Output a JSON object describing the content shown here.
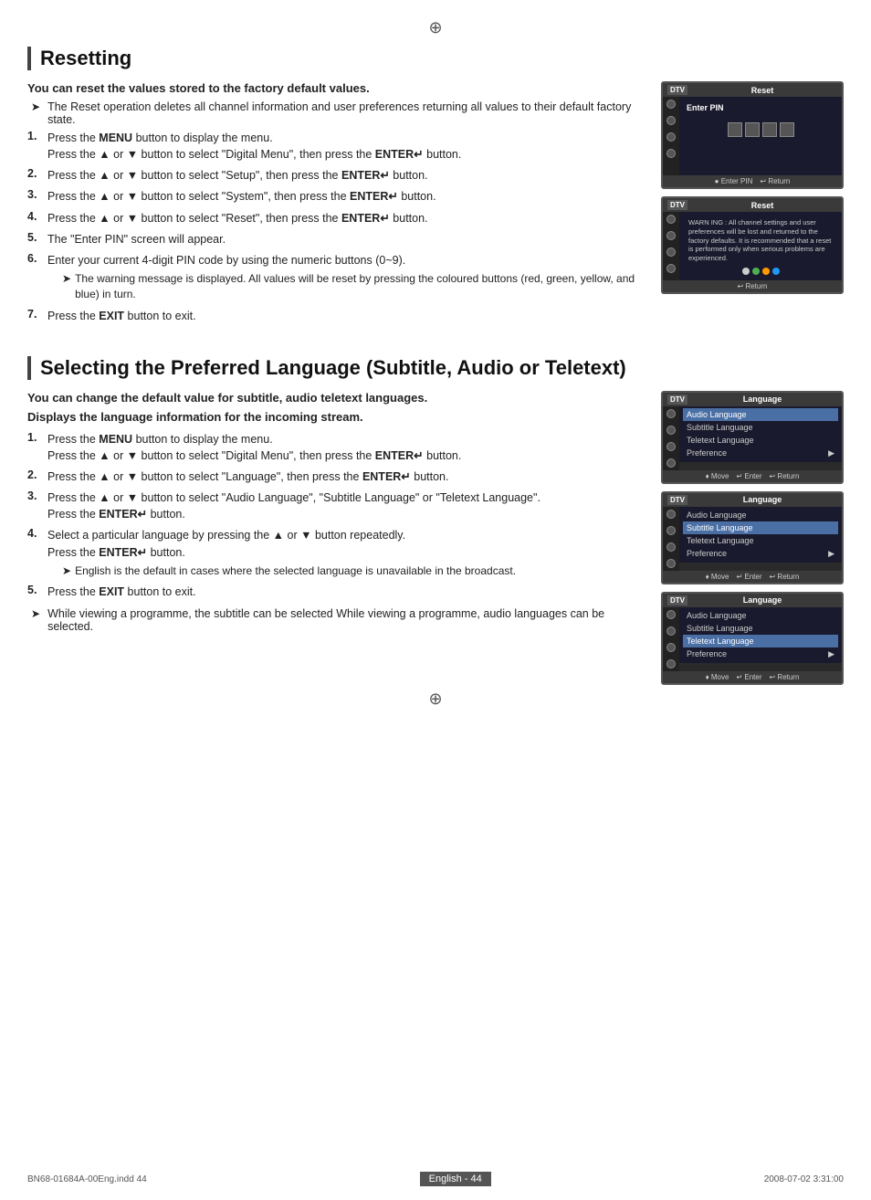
{
  "page": {
    "title": "Resetting",
    "subtitle": "Selecting the Preferred Language (Subtitle, Audio or Teletext)",
    "footer_text": "English - 44",
    "file_info": "BN68-01684A-00Eng.indd   44",
    "date_info": "2008-07-02     3:31:00"
  },
  "resetting": {
    "intro_bold": "You can reset the values stored to the factory default values.",
    "note1": "The Reset operation deletes all channel information and user preferences returning all values to their default factory state.",
    "steps": [
      {
        "num": "1.",
        "text": "Press the MENU button to display the menu.\nPress the ▲ or ▼ button to select \"Digital Menu\", then press the ENTER↵ button."
      },
      {
        "num": "2.",
        "text": "Press the ▲ or ▼ button to select \"Setup\", then press the ENTER↵ button."
      },
      {
        "num": "3.",
        "text": "Press the ▲ or ▼ button to select \"System\", then press the ENTER↵ button."
      },
      {
        "num": "4.",
        "text": "Press the ▲ or ▼ button to select \"Reset\", then press the ENTER↵ button."
      },
      {
        "num": "5.",
        "text": "The \"Enter PIN\" screen will appear."
      },
      {
        "num": "6.",
        "text": "Enter your current 4-digit PIN code by using the numeric buttons (0~9).",
        "sub_note": "The warning message is displayed. All values will be reset by pressing the coloured buttons (red, green, yellow, and blue) in turn."
      },
      {
        "num": "7.",
        "text": "Press the EXIT button to exit."
      }
    ],
    "screen1": {
      "dtv": "DTV",
      "title": "Reset",
      "label": "Enter PIN",
      "footer_items": [
        "● Enter PIN",
        "↩ Return"
      ]
    },
    "screen2": {
      "dtv": "DTV",
      "title": "Reset",
      "warning": "WARN ING : All channel settings and user preferences will be lost and returned to the factory defaults. It is recommended that a reset is performed only when serious problems are experienced.",
      "footer_items": [
        "↩ Return"
      ],
      "color_buttons": [
        "red",
        "green",
        "yellow",
        "blue"
      ]
    }
  },
  "language": {
    "intro_bold": "You can change the default value for subtitle, audio teletext languages.",
    "intro_bold2": "Displays the language information for the incoming stream.",
    "steps": [
      {
        "num": "1.",
        "text": "Press the MENU button to display the menu.\nPress the ▲ or ▼ button to select \"Digital Menu\", then press the ENTER↵ button."
      },
      {
        "num": "2.",
        "text": "Press the ▲ or ▼ button to select \"Language\", then press the ENTER↵ button."
      },
      {
        "num": "3.",
        "text": "Press the ▲ or ▼ button to select \"Audio Language\", \"Subtitle Language\" or \"Teletext Language\".\nPress the ENTER↵ button."
      },
      {
        "num": "4.",
        "text": "Select a particular language by pressing the ▲ or ▼ button repeatedly.\nPress the ENTER↵ button.",
        "sub_note": "English is the default in cases where the selected language is unavailable in the broadcast."
      },
      {
        "num": "5.",
        "text": "Press the EXIT button to exit."
      }
    ],
    "note1": "While viewing a programme, the subtitle can be selected While viewing a programme, audio languages can be selected.",
    "screens": [
      {
        "dtv": "DTV",
        "title": "Language",
        "items": [
          "Audio Language",
          "Subtitle Language",
          "Teletext Language",
          "Preference"
        ],
        "selected": "Audio Language",
        "footer": [
          "♦ Move",
          "↵ Enter",
          "↩ Return"
        ]
      },
      {
        "dtv": "DTV",
        "title": "Language",
        "items": [
          "Audio Language",
          "Subtitle Language",
          "Teletext Language",
          "Preference"
        ],
        "selected": "Subtitle Language",
        "footer": [
          "♦ Move",
          "↵ Enter",
          "↩ Return"
        ]
      },
      {
        "dtv": "DTV",
        "title": "Language",
        "items": [
          "Audio Language",
          "Subtitle Language",
          "Teletext Language",
          "Preference"
        ],
        "selected": "Teletext Language",
        "footer": [
          "♦ Move",
          "↵ Enter",
          "↩ Return"
        ]
      }
    ]
  }
}
